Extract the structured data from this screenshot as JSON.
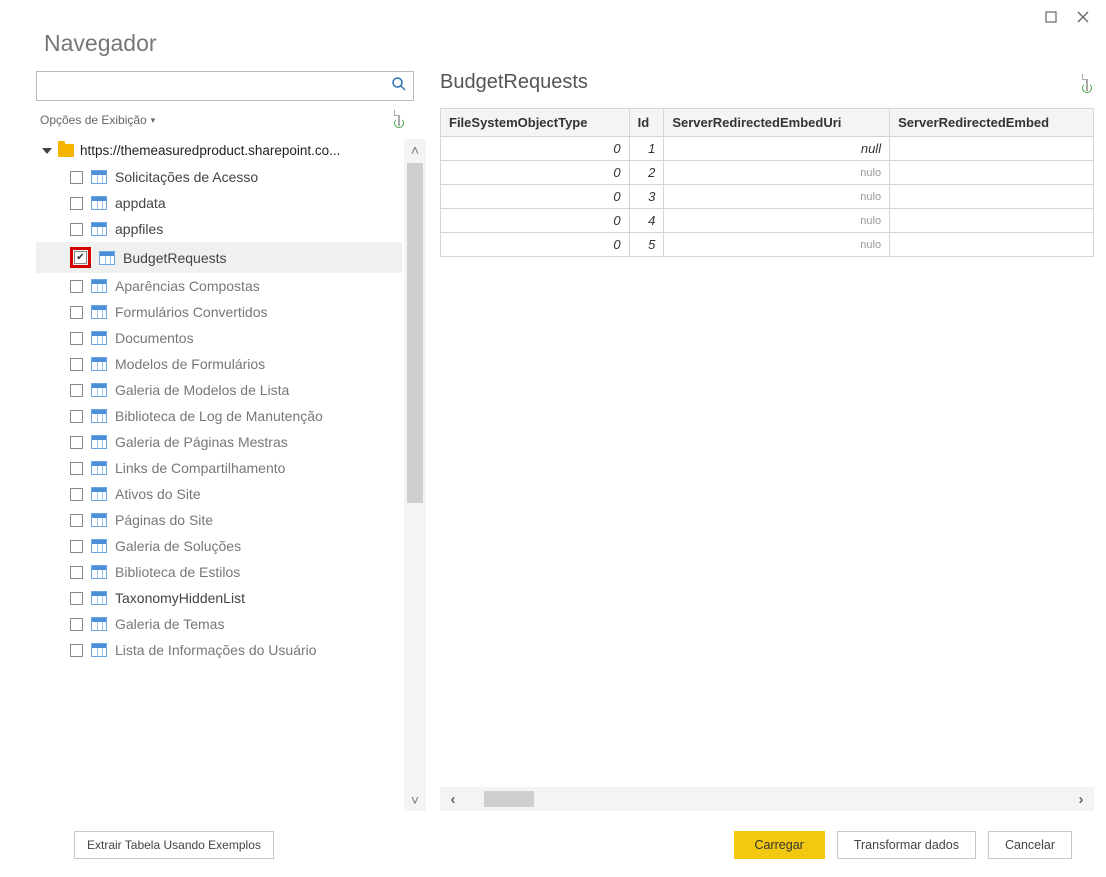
{
  "window": {
    "title": "Navegador"
  },
  "search": {
    "placeholder": ""
  },
  "display_options_label": "Opções de Exibição",
  "tree": {
    "root_label": "https://themeasuredproduct.sharepoint.co...",
    "items": [
      {
        "label": "Solicitações de Acesso",
        "checked": false,
        "grayed": false
      },
      {
        "label": "appdata",
        "checked": false,
        "grayed": false
      },
      {
        "label": "appfiles",
        "checked": false,
        "grayed": false
      },
      {
        "label": "BudgetRequests",
        "checked": true,
        "grayed": false,
        "selected": true,
        "highlight": true
      },
      {
        "label": "Aparências Compostas",
        "checked": false,
        "grayed": true
      },
      {
        "label": "Formulários Convertidos",
        "checked": false,
        "grayed": true
      },
      {
        "label": "Documentos",
        "checked": false,
        "grayed": true
      },
      {
        "label": "Modelos de Formulários",
        "checked": false,
        "grayed": true
      },
      {
        "label": "Galeria de Modelos de Lista",
        "checked": false,
        "grayed": true
      },
      {
        "label": "Biblioteca de Log de Manutenção",
        "checked": false,
        "grayed": true
      },
      {
        "label": "Galeria de Páginas Mestras",
        "checked": false,
        "grayed": true
      },
      {
        "label": "Links de Compartilhamento",
        "checked": false,
        "grayed": true
      },
      {
        "label": "Ativos do Site",
        "checked": false,
        "grayed": true
      },
      {
        "label": "Páginas do Site",
        "checked": false,
        "grayed": true
      },
      {
        "label": "Galeria de Soluções",
        "checked": false,
        "grayed": true
      },
      {
        "label": "Biblioteca de Estilos",
        "checked": false,
        "grayed": true
      },
      {
        "label": "TaxonomyHiddenList",
        "checked": false,
        "grayed": false
      },
      {
        "label": "Galeria de Temas",
        "checked": false,
        "grayed": true
      },
      {
        "label": "Lista de Informações do Usuário",
        "checked": false,
        "grayed": true
      }
    ]
  },
  "preview": {
    "title": "BudgetRequests",
    "columns": [
      "FileSystemObjectType",
      "Id",
      "ServerRedirectedEmbedUri",
      "ServerRedirectedEmbed"
    ],
    "rows": [
      {
        "c0": "0",
        "c1": "1",
        "c2": "null",
        "c2_style": "nullc"
      },
      {
        "c0": "0",
        "c1": "2",
        "c2": "nulo",
        "c2_style": "nulo"
      },
      {
        "c0": "0",
        "c1": "3",
        "c2": "nulo",
        "c2_style": "nulo"
      },
      {
        "c0": "0",
        "c1": "4",
        "c2": "nulo",
        "c2_style": "nulo"
      },
      {
        "c0": "0",
        "c1": "5",
        "c2": "nulo",
        "c2_style": "nulo"
      }
    ]
  },
  "footer": {
    "extract_label": "Extrair Tabela Usando Exemplos",
    "load_label": "Carregar",
    "transform_label": "Transformar dados",
    "cancel_label": "Cancelar"
  }
}
